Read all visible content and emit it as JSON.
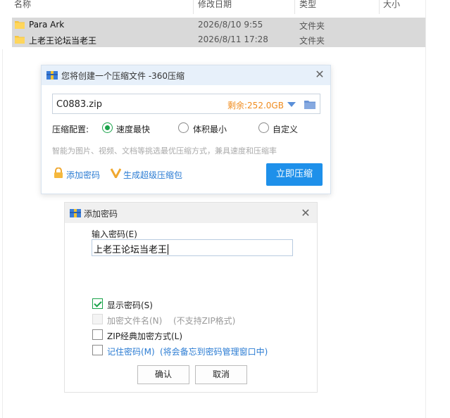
{
  "explorer": {
    "columns": {
      "name": "名称",
      "date": "修改日期",
      "type": "类型",
      "size": "大小"
    },
    "rows": [
      {
        "name": "Para Ark",
        "date": "2026/8/10 9:55",
        "type": "文件夹"
      },
      {
        "name": "上老王论坛当老王",
        "date": "2026/8/11 17:28",
        "type": "文件夹"
      }
    ]
  },
  "zip_dialog": {
    "title": "您将创建一个压缩文件 -360压缩",
    "filename": "C0883.zip",
    "free_space": "剩余:252.0GB",
    "config_label": "压缩配置:",
    "options": [
      "速度最快",
      "体积最小",
      "自定义"
    ],
    "selected_option": "速度最快",
    "hint": "智能为图片、视频、文档等挑选最优压缩方式，兼具速度和压缩率",
    "add_password": "添加密码",
    "super_zip": "生成超级压缩包",
    "compress_now": "立即压缩",
    "accent_color": "#1e90ea",
    "free_space_color": "#f08c1e"
  },
  "password_dialog": {
    "title": "添加密码",
    "input_label": "输入密码(E)",
    "password_value": "上老王论坛当老王",
    "show_password": "显示密码(S)",
    "encrypt_filenames": "加密文件名(N)",
    "encrypt_filenames_note": "(不支持ZIP格式)",
    "zip_classic": "ZIP经典加密方式(L)",
    "remember_password": "记住密码(M)",
    "remember_note": "(将会备忘到密码管理窗口中)",
    "confirm": "确认",
    "cancel": "取消",
    "checks": {
      "show_password": true,
      "encrypt_filenames": false,
      "zip_classic": false,
      "remember_password": false
    }
  }
}
